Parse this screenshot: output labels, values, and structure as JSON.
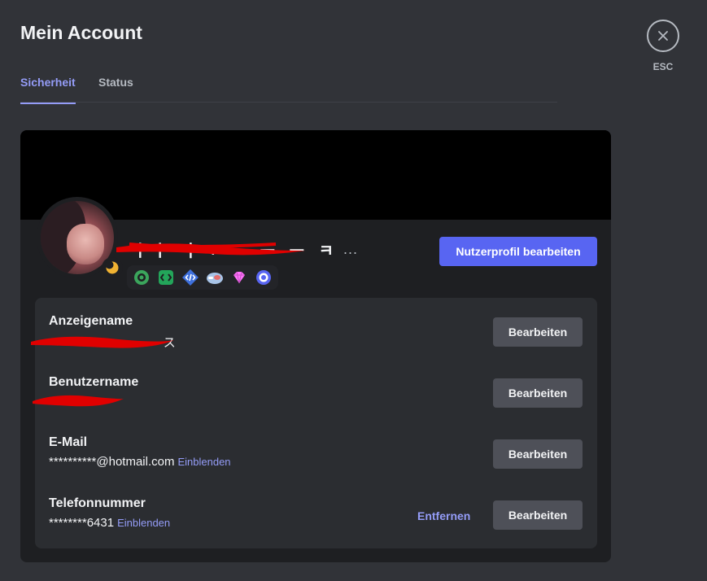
{
  "page": {
    "title": "Mein Account",
    "tabs": [
      {
        "label": "Sicherheit",
        "active": true
      },
      {
        "label": "Status",
        "active": false
      }
    ],
    "close": {
      "label": "ESC",
      "icon": "close-icon"
    }
  },
  "profile": {
    "username_visible": "ㅣㅣ ㅓㅋ ㅡ ㅡ ㅡ ㅋ",
    "username_overflow": "...",
    "edit_profile_label": "Nutzerprofil bearbeiten",
    "status": "idle",
    "badges": [
      "nitro-badge",
      "active-developer-badge",
      "developer-badge",
      "hypesquad-badge",
      "boost-gem-badge",
      "quest-badge"
    ]
  },
  "fields": [
    {
      "label": "Anzeigename",
      "value": "ヽㅋ ㅡ ㅡ ㅡ ㅡ ㅡ ㅡ ス",
      "edit_label": "Bearbeiten",
      "redacted": true
    },
    {
      "label": "Benutzername",
      "value": "ㆍ ㆍ ㆍ ㆍ",
      "edit_label": "Bearbeiten",
      "redacted": true
    },
    {
      "label": "E-Mail",
      "value": "**********@hotmail.com",
      "reveal_label": "Einblenden",
      "edit_label": "Bearbeiten"
    },
    {
      "label": "Telefonnummer",
      "value": "********6431",
      "reveal_label": "Einblenden",
      "remove_label": "Entfernen",
      "edit_label": "Bearbeiten"
    }
  ],
  "colors": {
    "background": "#313338",
    "card": "#1e1f22",
    "panel": "#2b2d31",
    "accent": "#5865f2",
    "link": "#949cf7",
    "secondary_button": "#4e5058",
    "redaction": "#e00000"
  }
}
